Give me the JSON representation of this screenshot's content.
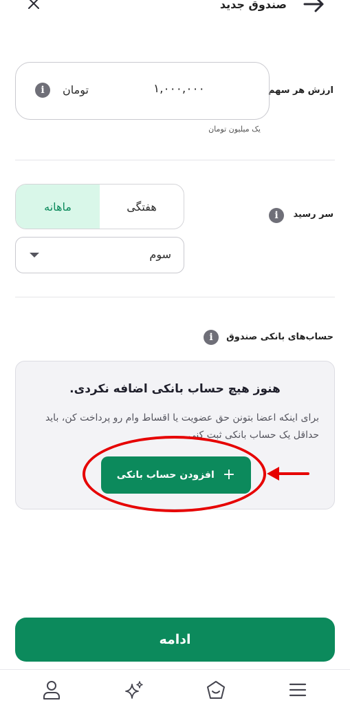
{
  "header": {
    "title": "صندوق جدید",
    "back_icon": "arrow-right-icon",
    "close_icon": "close-icon"
  },
  "share_value": {
    "label": "ارزش هر سهم",
    "amount": "۱,۰۰۰,۰۰۰",
    "unit": "تومان",
    "hint": "یک میلیون تومان",
    "info_icon": "info-icon"
  },
  "due": {
    "label": "سر رسید",
    "info_icon": "info-icon",
    "options": [
      "هفتگی",
      "ماهانه"
    ],
    "selected_option": "ماهانه",
    "select_value": "سوم"
  },
  "bank_accounts": {
    "label": "حساب‌های بانکی صندوق",
    "info_icon": "info-icon",
    "empty_title": "هنوز هیچ حساب بانکی اضافه نکردی.",
    "empty_description": "برای اینکه اعضا بتونن حق عضویت یا اقساط وام رو پرداخت کن، باید حداقل یک حساب بانکی ثبت کنی.",
    "add_button_label": "افزودن حساب بانکی"
  },
  "continue_label": "ادامه",
  "bottom_nav": {
    "items": [
      "profile-icon",
      "sparkle-icon",
      "home-icon",
      "menu-icon"
    ]
  },
  "colors": {
    "primary": "#0c8a5c",
    "toggle_active_bg": "#d9f7e9",
    "annotation_red": "#e60000"
  }
}
